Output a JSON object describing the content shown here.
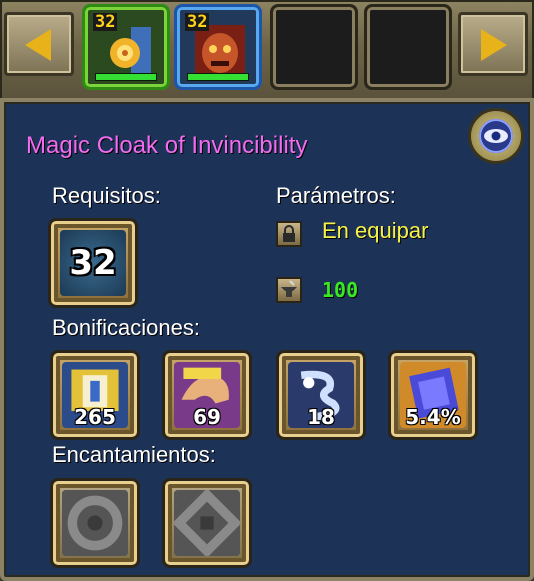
{
  "carousel": {
    "slots": [
      {
        "level": "32",
        "icon": "golden-amulet-icon",
        "frame": "green",
        "health_fraction": 1.0
      },
      {
        "level": "32",
        "icon": "demon-mask-icon",
        "frame": "blue",
        "health_fraction": 1.0
      },
      {
        "level": "",
        "icon": "empty-slot-icon",
        "frame": "default"
      },
      {
        "level": "",
        "icon": "empty-slot-icon",
        "frame": "default"
      }
    ]
  },
  "item": {
    "name": "Magic Cloak of Invincibility",
    "name_color": "#f26bf0"
  },
  "requirements": {
    "label": "Requisitos:",
    "level": "32"
  },
  "parameters": {
    "label": "Parámetros:",
    "bind_text": "En equipar",
    "durability": "100"
  },
  "bonuses": {
    "label": "Bonificaciones:",
    "items": [
      {
        "icon": "armor-shield-icon",
        "value": "265"
      },
      {
        "icon": "strength-arm-icon",
        "value": "69"
      },
      {
        "icon": "agility-whirlwind-icon",
        "value": "18"
      },
      {
        "icon": "spellbook-icon",
        "value": "5.4%"
      }
    ]
  },
  "enchantments": {
    "label": "Encantamientos:",
    "slots": [
      {
        "icon": "enchant-slot-round-icon"
      },
      {
        "icon": "enchant-slot-square-icon"
      }
    ]
  },
  "colors": {
    "panel_bg": "#1d3257",
    "param_text": "#f6f24a",
    "durability_text": "#39e81e"
  }
}
